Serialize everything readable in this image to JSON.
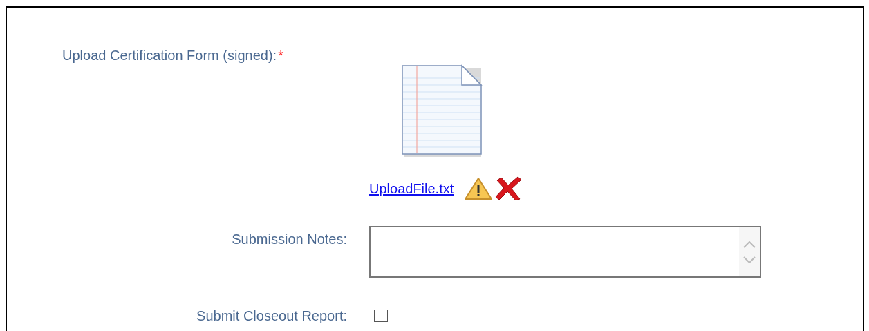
{
  "fields": [
    {
      "kind": "upload",
      "label": "Upload Certification Form (signed):",
      "required": true,
      "required_mark": "*",
      "file_name": "UploadFile.txt"
    },
    {
      "kind": "textarea",
      "label": "Submission Notes:",
      "required": false
    },
    {
      "kind": "checkbox",
      "label": "Submit Closeout Report:",
      "required": false,
      "checked": false
    }
  ]
}
